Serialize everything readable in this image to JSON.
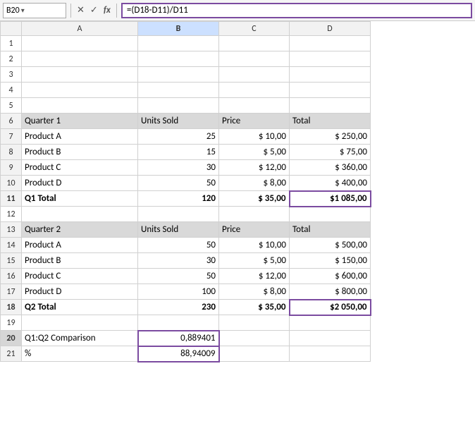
{
  "formulaBar": {
    "nameBox": "B20",
    "nameBoxDropdownIcon": "▾",
    "iconX": "✕",
    "iconCheck": "✓",
    "iconFx": "fx",
    "formula": "=(D18-D11)/D11"
  },
  "columns": {
    "corner": "",
    "headers": [
      "A",
      "B",
      "C",
      "D"
    ]
  },
  "rows": {
    "rowNums": [
      "1",
      "2",
      "3",
      "4",
      "5",
      "6",
      "7",
      "8",
      "9",
      "10",
      "11",
      "12",
      "13",
      "14",
      "15",
      "16",
      "17",
      "18",
      "19",
      "20",
      "21"
    ],
    "data": {
      "r6": {
        "A": "Quarter 1",
        "B": "Units Sold",
        "C": "Price",
        "D": "Total",
        "type": "section-header"
      },
      "r7": {
        "A": "Product A",
        "B": "25",
        "C": "$ 10,00",
        "D": "$ 250,00",
        "type": "data"
      },
      "r8": {
        "A": "Product B",
        "B": "15",
        "C": "$ 5,00",
        "D": "$ 75,00",
        "type": "data"
      },
      "r9": {
        "A": "Product C",
        "B": "30",
        "C": "$ 12,00",
        "D": "$ 360,00",
        "type": "data"
      },
      "r10": {
        "A": "Product D",
        "B": "50",
        "C": "$ 8,00",
        "D": "$ 400,00",
        "type": "data"
      },
      "r11": {
        "A": "Q1 Total",
        "B": "120",
        "C": "$ 35,00",
        "D": "$1 085,00",
        "type": "total"
      },
      "r12": {
        "A": "",
        "B": "",
        "C": "",
        "D": "",
        "type": "empty"
      },
      "r13": {
        "A": "Quarter 2",
        "B": "Units Sold",
        "C": "Price",
        "D": "Total",
        "type": "section-header"
      },
      "r14": {
        "A": "Product A",
        "B": "50",
        "C": "$ 10,00",
        "D": "$ 500,00",
        "type": "data"
      },
      "r15": {
        "A": "Product B",
        "B": "30",
        "C": "$ 5,00",
        "D": "$ 150,00",
        "type": "data"
      },
      "r16": {
        "A": "Product C",
        "B": "50",
        "C": "$ 12,00",
        "D": "$ 600,00",
        "type": "data"
      },
      "r17": {
        "A": "Product D",
        "B": "100",
        "C": "$ 8,00",
        "D": "$ 800,00",
        "type": "data"
      },
      "r18": {
        "A": "Q2 Total",
        "B": "230",
        "C": "$ 35,00",
        "D": "$2 050,00",
        "type": "total"
      },
      "r19": {
        "A": "",
        "B": "",
        "C": "",
        "D": "",
        "type": "empty"
      },
      "r20": {
        "A": "Q1:Q2 Comparison",
        "B": "0,889401",
        "C": "",
        "D": "",
        "type": "comparison"
      },
      "r21": {
        "A": "%",
        "B": "88,94009",
        "C": "",
        "D": "",
        "type": "comparison"
      }
    }
  }
}
